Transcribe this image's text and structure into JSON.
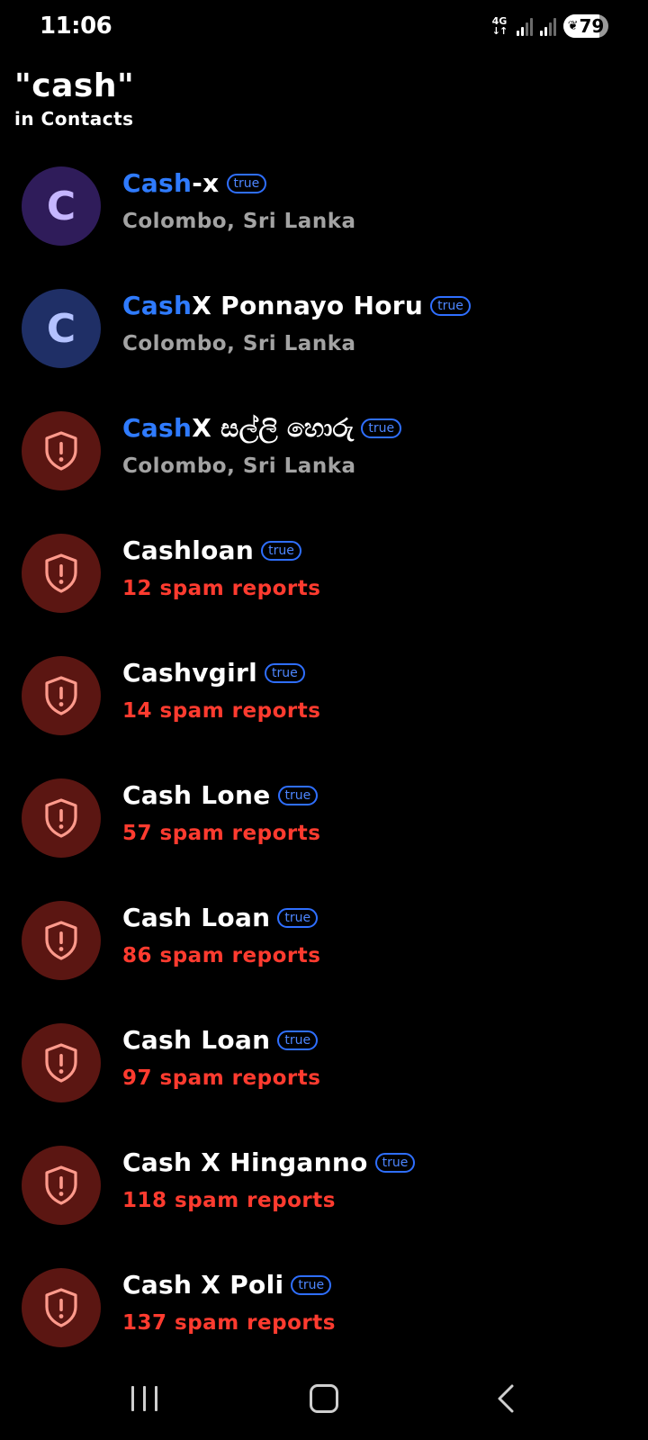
{
  "status_bar": {
    "time": "11:06",
    "network_type": "4G",
    "network_arrows": "↓↑",
    "battery_percent": 79,
    "battery_label": "79",
    "battery_leaf_icon": "leaf-icon"
  },
  "header": {
    "query": "\"cash\"",
    "scope": "in Contacts"
  },
  "colors": {
    "highlight": "#2f7bff",
    "spam_text": "#ff3b2f",
    "location_text": "#a3a3a3",
    "badge": "#2f6fff"
  },
  "results": [
    {
      "highlight": "Cash",
      "rest": "-x",
      "badge": "true",
      "subtitle": "Colombo, Sri Lanka",
      "sub_type": "location",
      "avatar": {
        "type": "letter",
        "letter": "C",
        "style": "purple"
      }
    },
    {
      "highlight": "Cash",
      "rest": "X Ponnayo Horu",
      "badge": "true",
      "subtitle": "Colombo, Sri Lanka",
      "sub_type": "location",
      "avatar": {
        "type": "letter",
        "letter": "C",
        "style": "blue"
      }
    },
    {
      "highlight": "Cash",
      "rest": "X සල්ලි හොරු",
      "badge": "true",
      "subtitle": "Colombo, Sri Lanka",
      "sub_type": "location",
      "avatar": {
        "type": "spam",
        "icon": "shield-alert-icon"
      }
    },
    {
      "highlight": "",
      "rest": "Cashloan",
      "badge": "true",
      "subtitle": "12 spam reports",
      "sub_type": "spam",
      "avatar": {
        "type": "spam",
        "icon": "shield-alert-icon"
      }
    },
    {
      "highlight": "",
      "rest": "Cashvgirl",
      "badge": "true",
      "subtitle": "14 spam reports",
      "sub_type": "spam",
      "avatar": {
        "type": "spam",
        "icon": "shield-alert-icon"
      }
    },
    {
      "highlight": "",
      "rest": "Cash Lone",
      "badge": "true",
      "subtitle": "57 spam reports",
      "sub_type": "spam",
      "avatar": {
        "type": "spam",
        "icon": "shield-alert-icon"
      }
    },
    {
      "highlight": "",
      "rest": "Cash Loan",
      "badge": "true",
      "subtitle": "86 spam reports",
      "sub_type": "spam",
      "avatar": {
        "type": "spam",
        "icon": "shield-alert-icon"
      }
    },
    {
      "highlight": "",
      "rest": "Cash Loan",
      "badge": "true",
      "subtitle": "97 spam reports",
      "sub_type": "spam",
      "avatar": {
        "type": "spam",
        "icon": "shield-alert-icon"
      }
    },
    {
      "highlight": "",
      "rest": "Cash X Hinganno",
      "badge": "true",
      "subtitle": "118 spam reports",
      "sub_type": "spam",
      "avatar": {
        "type": "spam",
        "icon": "shield-alert-icon"
      }
    },
    {
      "highlight": "",
      "rest": "Cash X Poli",
      "badge": "true",
      "subtitle": "137 spam reports",
      "sub_type": "spam",
      "avatar": {
        "type": "spam",
        "icon": "shield-alert-icon"
      }
    }
  ],
  "nav_bar": {
    "recents_icon": "recents-icon",
    "home_icon": "home-icon",
    "back_icon": "back-icon"
  }
}
